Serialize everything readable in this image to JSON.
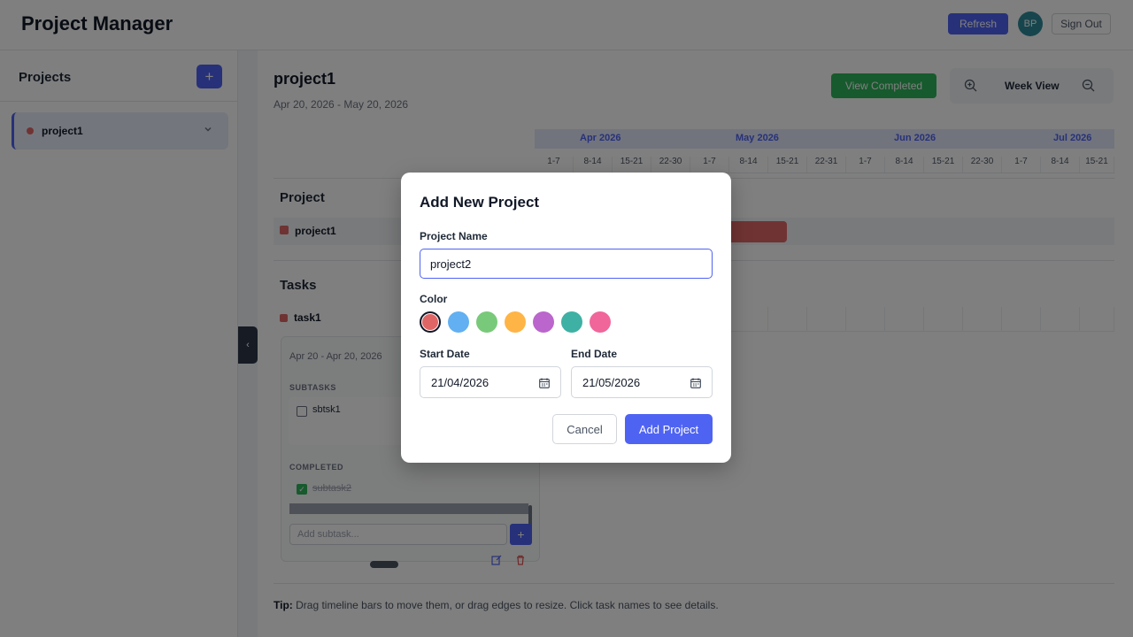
{
  "header": {
    "title": "Project Manager",
    "refresh_label": "Refresh",
    "avatar_initials": "BP",
    "signout_label": "Sign Out"
  },
  "sidebar": {
    "title": "Projects",
    "add_label": "+",
    "projects": [
      {
        "name": "project1",
        "color": "#e06666"
      }
    ],
    "collapse_glyph": "‹"
  },
  "main": {
    "title": "project1",
    "range": "Apr 20, 2026 - May 20, 2026",
    "view_completed_label": "View Completed",
    "view_mode": "Week View",
    "months": [
      "Apr 2026",
      "May 2026",
      "Jun 2026",
      "Jul 2026"
    ],
    "weeks": [
      "1-7",
      "8-14",
      "15-21",
      "22-30",
      "1-7",
      "8-14",
      "15-21",
      "22-31",
      "1-7",
      "8-14",
      "15-21",
      "22-30",
      "1-7",
      "8-14",
      "15-21"
    ],
    "project_section": "Project",
    "project_row": "project1",
    "tasks_section": "Tasks",
    "task_row": "task1",
    "task_panel": {
      "range": "Apr 20 - Apr 20, 2026",
      "subtasks_heading": "SUBTASKS",
      "subtask": "sbtsk1",
      "completed_heading": "COMPLETED",
      "completed_subtask": "subtask2",
      "add_placeholder": "Add subtask...",
      "add_label": "+"
    },
    "tip_label": "Tip:",
    "tip_text": " Drag timeline bars to move them, or drag edges to resize. Click task names to see details."
  },
  "modal": {
    "title": "Add New Project",
    "name_label": "Project Name",
    "name_value": "project2",
    "color_label": "Color",
    "colors": [
      "#e06666",
      "#62b0f2",
      "#79c97a",
      "#ffb446",
      "#bb66cc",
      "#3fb0a4",
      "#f0669a"
    ],
    "selected_color": "#e06666",
    "start_label": "Start Date",
    "start_value": "21/04/2026",
    "end_label": "End Date",
    "end_value": "21/05/2026",
    "cancel_label": "Cancel",
    "submit_label": "Add Project"
  }
}
